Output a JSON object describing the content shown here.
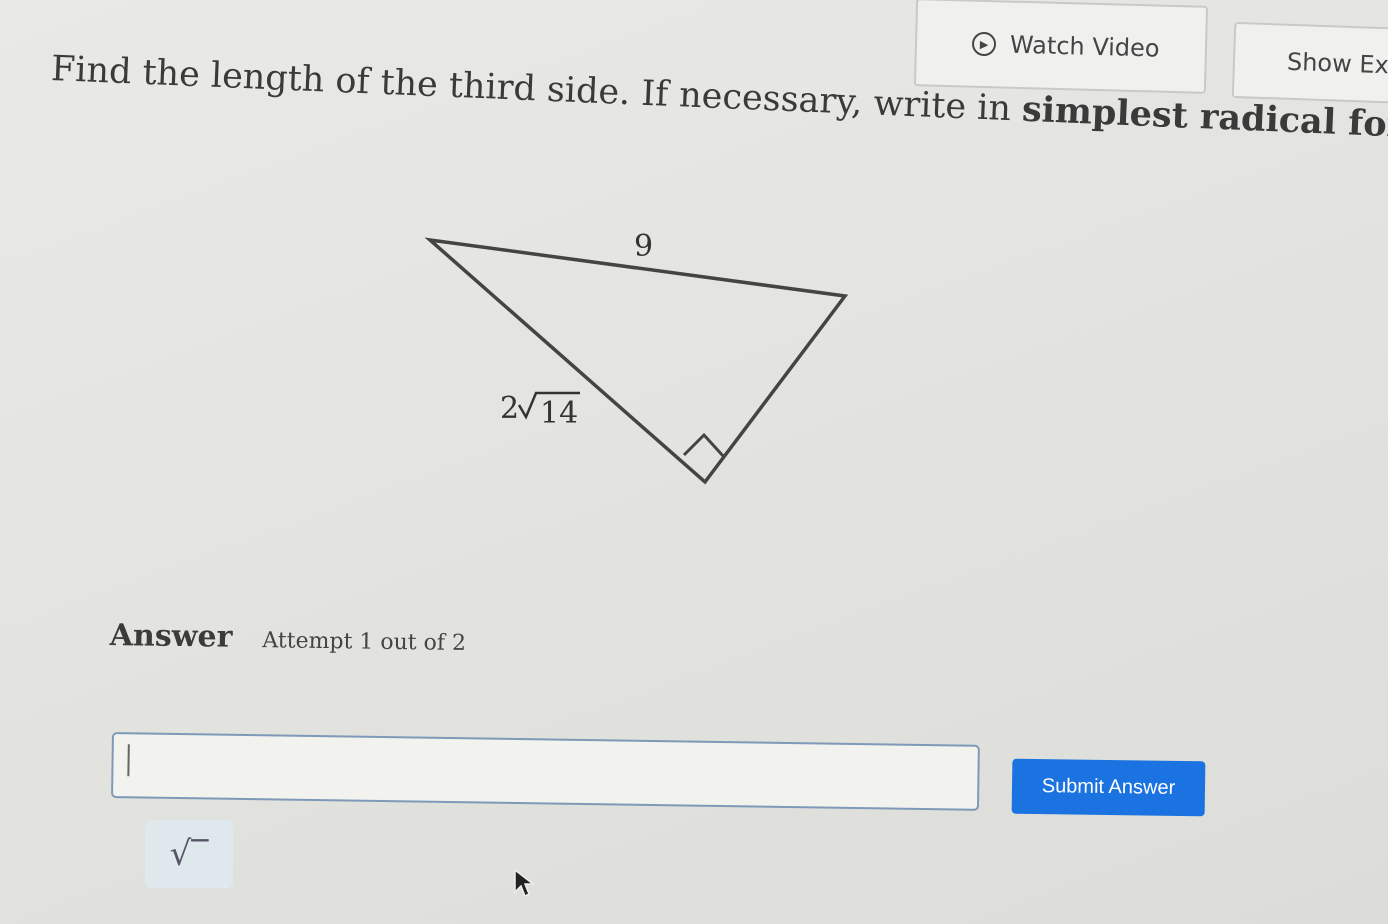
{
  "toolbar": {
    "watch_video_label": "Watch Video",
    "show_example_label": "Show Exa"
  },
  "question": {
    "prefix": "Find the length of the third side. If necessary, write in ",
    "emphasis": "simplest radical form."
  },
  "triangle": {
    "top_side_label": "9",
    "leg_label_coefficient": "2",
    "leg_label_radicand": "14",
    "right_angle_marker": true
  },
  "answer": {
    "heading": "Answer",
    "attempt_text": "Attempt 1 out of 2",
    "input_value": "",
    "submit_label": "Submit Answer",
    "sqrt_button_symbol": "√‾"
  },
  "colors": {
    "accent": "#1a73e0",
    "input_border": "#7f99b8",
    "background": "#e6e6e3"
  }
}
